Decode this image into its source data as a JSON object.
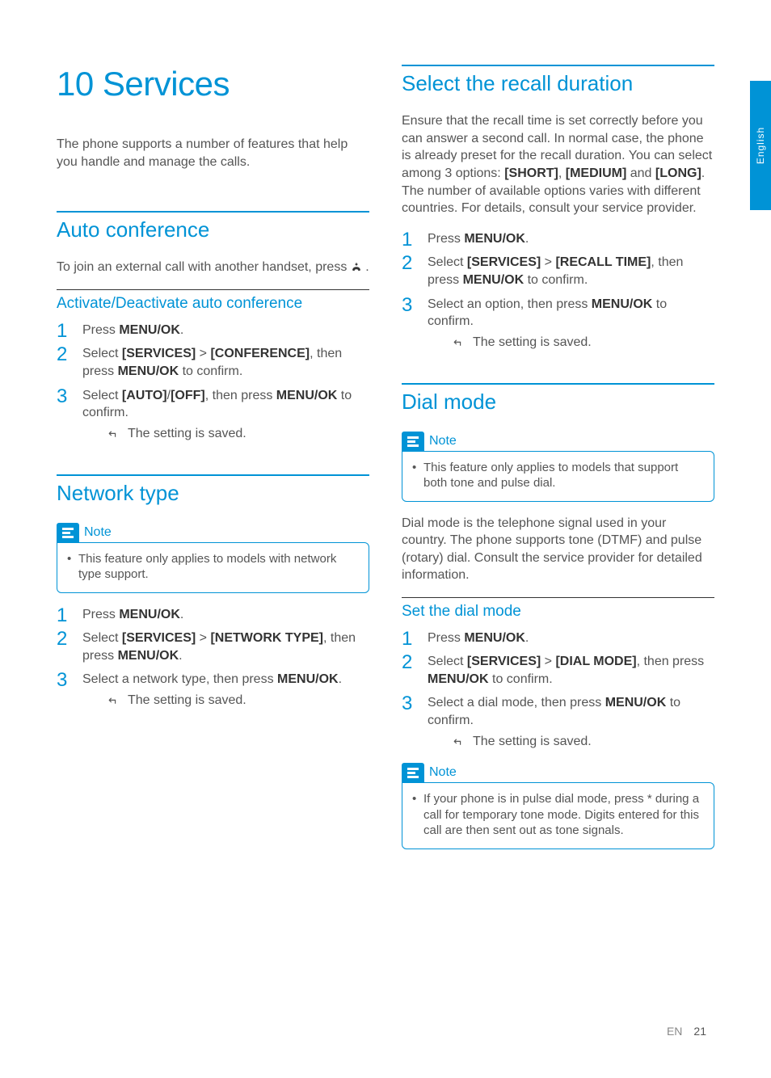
{
  "side_tab": "English",
  "chapter": {
    "number": "10",
    "title": "Services"
  },
  "intro": "The phone supports a number of features that help you handle and manage the calls.",
  "menu_ok": "MENU/OK",
  "auto_conf": {
    "title": "Auto conference",
    "body_a": "To join an external call with another handset, press ",
    "body_b": " .",
    "sub_title": "Activate/Deactivate auto conference",
    "s1": "Press ",
    "s1b": ".",
    "s2a": "Select ",
    "s2b": "[SERVICES]",
    "s2c": " > ",
    "s2d": "[CONFERENCE]",
    "s2e": ", then press ",
    "s2f": " to confirm.",
    "s3a": "Select ",
    "s3b": "[AUTO]",
    "s3c": "/",
    "s3d": "[OFF]",
    "s3e": ", then press ",
    "s3f": " to confirm.",
    "r": "The setting is saved."
  },
  "network": {
    "title": "Network type",
    "note": "This feature only applies to models with network type support.",
    "s1": "Press ",
    "s1b": ".",
    "s2a": "Select ",
    "s2b": "[SERVICES]",
    "s2c": " > ",
    "s2d": "[NETWORK TYPE]",
    "s2e": ", then press ",
    "s2f": ".",
    "s3a": "Select a network type, then press ",
    "s3b": "MENU/OK",
    "s3c": ".",
    "r": "The setting is saved."
  },
  "recall": {
    "title": "Select the recall duration",
    "p_a": "Ensure that the recall time is set correctly before you can answer a second call. In normal case, the phone is already preset for the recall duration. You can select among 3 options: ",
    "p_b1": "[SHORT]",
    "p_b2": ", ",
    "p_b3": "[MEDIUM]",
    "p_b4": " and ",
    "p_b5": "[LONG]",
    "p_c": ". The number of available options varies with different countries. For details, consult your service provider.",
    "s1": "Press ",
    "s1b": ".",
    "s2a": "Select ",
    "s2b": "[SERVICES]",
    "s2c": " > ",
    "s2d": "[RECALL TIME]",
    "s2e": ", then press ",
    "s2f": " to confirm.",
    "s3a": "Select an option, then press ",
    "s3b": " to confirm.",
    "r": "The setting is saved."
  },
  "dial": {
    "title": "Dial mode",
    "note1": "This feature only applies to models that support both tone and pulse dial.",
    "p": "Dial mode is the telephone signal used in your country. The phone supports tone (DTMF) and pulse (rotary) dial. Consult the service provider for detailed information.",
    "sub_title": "Set the dial mode",
    "s1": "Press ",
    "s1b": ".",
    "s2a": "Select ",
    "s2b": "[SERVICES]",
    "s2c": " > ",
    "s2d": "[DIAL MODE]",
    "s2e": ", then press ",
    "s2f": " to confirm.",
    "s3a": "Select a dial mode, then press ",
    "s3b": " to confirm.",
    "r": "The setting is saved.",
    "note2": "If your phone is in pulse dial mode, press * during a call for temporary tone mode. Digits entered for this call are then sent out as tone signals."
  },
  "note_label": "Note",
  "footer": {
    "lang": "EN",
    "page": "21"
  }
}
